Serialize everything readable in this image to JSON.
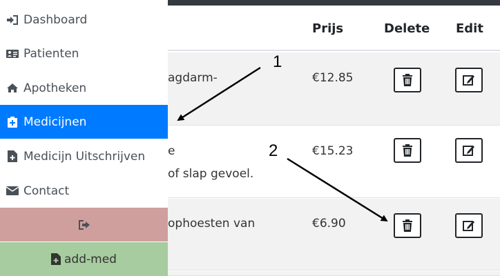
{
  "table": {
    "headers": {
      "prijs": "Prijs",
      "delete": "Delete",
      "edit": "Edit"
    },
    "rows": [
      {
        "desc_lines": [
          "agdarm-"
        ],
        "price": "€12.85"
      },
      {
        "desc_lines": [
          "e",
          "of slap gevoel."
        ],
        "price": "€15.23"
      },
      {
        "desc_lines": [
          "ophoesten van"
        ],
        "price": "€6.90"
      }
    ]
  },
  "sidebar": {
    "items": [
      {
        "label": "Dashboard",
        "icon": "sign-in-icon"
      },
      {
        "label": "Patienten",
        "icon": "id-card-icon"
      },
      {
        "label": "Apotheken",
        "icon": "home-icon"
      },
      {
        "label": "Medicijnen",
        "icon": "medkit-icon",
        "active": true
      },
      {
        "label": "Medicijn Uitschrijven",
        "icon": "file-medical-icon"
      },
      {
        "label": "Contact",
        "icon": "envelope-icon"
      }
    ],
    "logout_icon": "sign-out-icon",
    "add_med": {
      "label": "add-med",
      "icon": "file-medical-icon"
    }
  },
  "annotations": {
    "one": "1",
    "two": "2"
  },
  "colors": {
    "active": "#007bff",
    "logout_bg": "#cf9f9e",
    "add_med_bg": "#a7cc9f",
    "stripe": "#f2f2f2",
    "topbar": "#343a40"
  }
}
